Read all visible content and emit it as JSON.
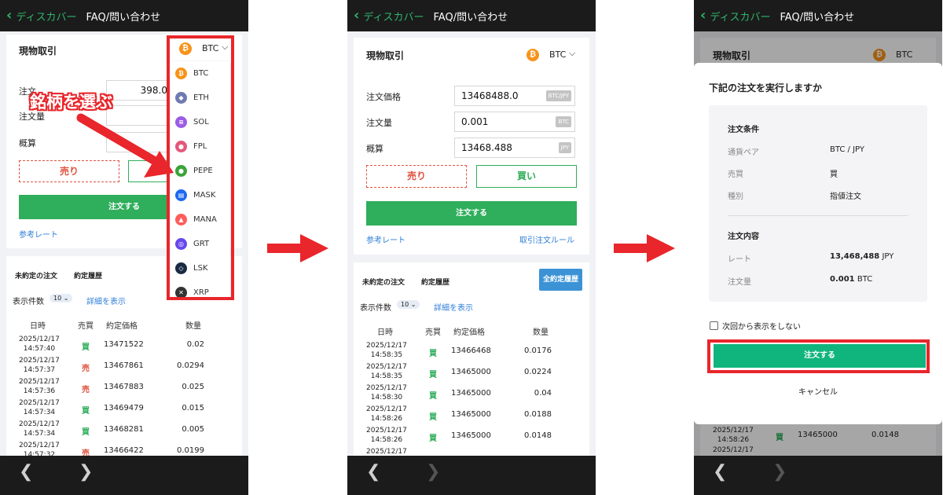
{
  "common": {
    "back_label": "ディスカバー",
    "title": "FAQ/問い合わせ",
    "nav_back": "❮",
    "nav_forward": "❯"
  },
  "colors": {
    "accent_green": "#2fae5b",
    "sell_red": "#e0533f",
    "highlight_red": "#e8262b",
    "link_blue": "#2f7fd8"
  },
  "screen1": {
    "section_title": "現物取引",
    "pair_selected": "BTC",
    "price_label_partial": "注文",
    "price_value_partial": "398.0",
    "qty_label": "注文量",
    "approx_label": "概算",
    "sell_label": "売り",
    "order_button": "注文する",
    "ref_rate_link": "参考レート",
    "callout": "銘柄を選ぶ",
    "tab_open": "未約定の注文",
    "tab_history": "約定履歴",
    "per_page_label": "表示件数",
    "per_page_value": "10",
    "show_details": "詳細を表示",
    "dropdown": [
      {
        "label": "BTC",
        "color": "#f7931a",
        "glyph": "₿"
      },
      {
        "label": "ETH",
        "color": "#6f7bb0",
        "glyph": "◆"
      },
      {
        "label": "SOL",
        "color": "#9b5de5",
        "glyph": "≡"
      },
      {
        "label": "FPL",
        "color": "#e4577a",
        "glyph": "●"
      },
      {
        "label": "PEPE",
        "color": "#3ba43b",
        "glyph": "●"
      },
      {
        "label": "MASK",
        "color": "#1c68f3",
        "glyph": "▤"
      },
      {
        "label": "MANA",
        "color": "#ff5c5c",
        "glyph": "▲"
      },
      {
        "label": "GRT",
        "color": "#6747ed",
        "glyph": "◎"
      },
      {
        "label": "LSK",
        "color": "#1a2a44",
        "glyph": "◇"
      },
      {
        "label": "XRP",
        "color": "#333333",
        "glyph": "✕"
      }
    ],
    "table_headers": [
      "日時",
      "売買",
      "約定価格",
      "数量"
    ],
    "rows": [
      {
        "date": "2025/12/17",
        "time": "14:57:40",
        "side": "買",
        "price": "13471522",
        "qty": "0.02"
      },
      {
        "date": "2025/12/17",
        "time": "14:57:37",
        "side": "売",
        "price": "13467861",
        "qty": "0.0294"
      },
      {
        "date": "2025/12/17",
        "time": "14:57:36",
        "side": "売",
        "price": "13467883",
        "qty": "0.025"
      },
      {
        "date": "2025/12/17",
        "time": "14:57:34",
        "side": "買",
        "price": "13469479",
        "qty": "0.015"
      },
      {
        "date": "2025/12/17",
        "time": "14:57:34",
        "side": "買",
        "price": "13468281",
        "qty": "0.005"
      },
      {
        "date": "2025/12/17",
        "time": "14:57:32",
        "side": "売",
        "price": "13466422",
        "qty": "0.0199"
      }
    ]
  },
  "screen2": {
    "section_title": "現物取引",
    "pair_selected": "BTC",
    "price_label": "注文価格",
    "price_value": "13468488.0",
    "price_unit": "BTC/JPY",
    "qty_label": "注文量",
    "qty_value": "0.001",
    "qty_unit": "BTC",
    "approx_label": "概算",
    "approx_value": "13468.488",
    "approx_unit": "JPY",
    "sell_label": "売り",
    "buy_label": "買い",
    "order_button": "注文する",
    "ref_rate_link": "参考レート",
    "rules_link": "取引注文ルール",
    "tab_open": "未約定の注文",
    "tab_history": "約定履歴",
    "all_history_button": "全約定履歴",
    "per_page_label": "表示件数",
    "per_page_value": "10",
    "show_details": "詳細を表示",
    "table_headers": [
      "日時",
      "売買",
      "約定価格",
      "数量"
    ],
    "rows": [
      {
        "date": "2025/12/17",
        "time": "14:58:35",
        "side": "買",
        "price": "13466468",
        "qty": "0.0176"
      },
      {
        "date": "2025/12/17",
        "time": "14:58:35",
        "side": "買",
        "price": "13465000",
        "qty": "0.0224"
      },
      {
        "date": "2025/12/17",
        "time": "14:58:30",
        "side": "買",
        "price": "13465000",
        "qty": "0.04"
      },
      {
        "date": "2025/12/17",
        "time": "14:58:26",
        "side": "買",
        "price": "13465000",
        "qty": "0.0188"
      },
      {
        "date": "2025/12/17",
        "time": "14:58:26",
        "side": "買",
        "price": "13465000",
        "qty": "0.0148"
      },
      {
        "date": "2025/12/17",
        "time": "",
        "side": "",
        "price": "",
        "qty": ""
      }
    ]
  },
  "screen3": {
    "section_title": "現物取引",
    "pair_selected": "BTC",
    "modal_title": "下記の注文を実行しますか",
    "conditions_header": "注文条件",
    "pair_key": "通貨ペア",
    "pair_value": "BTC / JPY",
    "side_key": "売買",
    "side_value": "買",
    "type_key": "種別",
    "type_value": "指値注文",
    "content_header": "注文内容",
    "rate_key": "レート",
    "rate_value": "13,468,488",
    "rate_unit": "JPY",
    "qty_key": "注文量",
    "qty_value": "0.001",
    "qty_unit": "BTC",
    "dont_show_again": "次回から表示をしない",
    "confirm_button": "注文する",
    "cancel_button": "キャンセル",
    "bg_row_date": "2025/12/17",
    "bg_row_time": "14:58:26",
    "bg_row_side": "買",
    "bg_row_price": "13465000",
    "bg_row_qty": "0.0148",
    "bg_row2_date": "2025/12/17"
  }
}
